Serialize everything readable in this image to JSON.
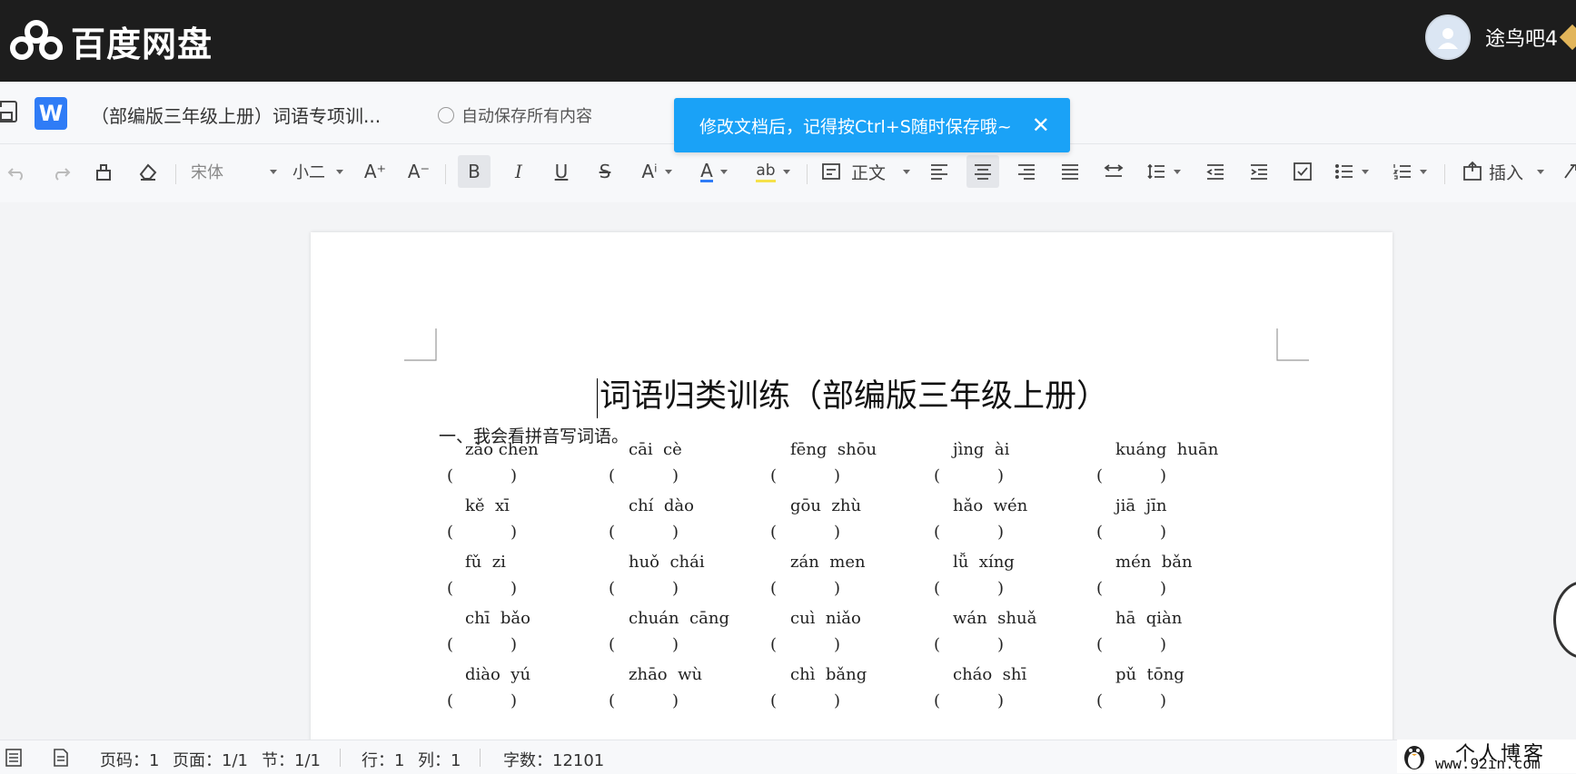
{
  "app": {
    "name": "百度网盘",
    "username": "途鸟吧4"
  },
  "doc": {
    "title": "（部编版三年级上册）词语专项训...",
    "autosave": "自动保存所有内容"
  },
  "toast": {
    "text": "修改文档后，记得按Ctrl+S随时保存哦~",
    "close": "✕"
  },
  "toolbar": {
    "font": "宋体",
    "size": "小二",
    "style": "正文",
    "insert": "插入",
    "grow": "A⁺",
    "shrink": "A⁻",
    "bold": "B",
    "italic": "I",
    "underline": "U",
    "strike": "S",
    "super": "Aⁱ",
    "color": "A",
    "highlight": "ab",
    "font_color": "#2f7cf6",
    "highlight_color": "#f5e14a"
  },
  "page": {
    "title": "词语归类训练（部编版三年级上册）",
    "section": "一、我会看拼音写词语。",
    "rows": [
      [
        "zǎo chen",
        "cāi  cè",
        "fēng  shōu",
        "jìng  ài",
        "kuáng  huān"
      ],
      [
        "kě  xī",
        "chí  dào",
        "gōu  zhù",
        "hǎo  wén",
        "jiā  jīn"
      ],
      [
        "fǔ  zi",
        "huǒ  chái",
        "zán  men",
        "lǚ  xíng",
        "mén  bǎn"
      ],
      [
        "chī  bǎo",
        "chuán  cāng",
        "cuì  niǎo",
        "wán  shuǎ",
        "hā  qiàn"
      ],
      [
        "diào  yú",
        "zhāo  wù",
        "chì  bǎng",
        "cháo  shī",
        "pǔ  tōng"
      ]
    ],
    "bracket": "(           )"
  },
  "status": {
    "page_no": "页码：1",
    "pages": "页面：1/1",
    "section": "节：1/1",
    "line": "行：1",
    "col": "列：1",
    "words": "字数：12101"
  },
  "watermark": {
    "title": "个人博客",
    "url": "www.92in.com"
  }
}
